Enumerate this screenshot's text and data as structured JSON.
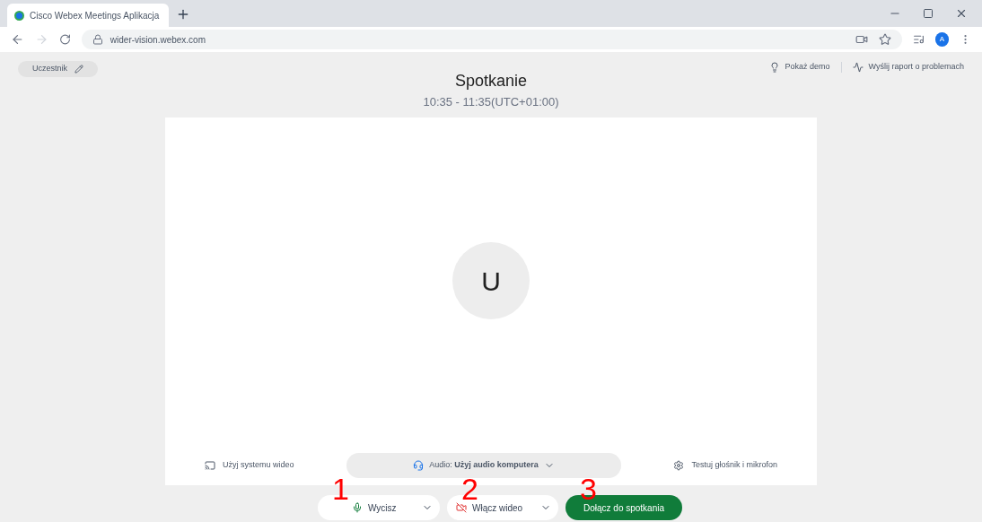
{
  "browser": {
    "tab_title": "Cisco Webex Meetings Aplikacja",
    "url": "wider-vision.webex.com",
    "profile_initial": "A"
  },
  "header": {
    "user_chip": "Uczestnik",
    "links": [
      {
        "kind": "demo",
        "label": "Pokaż demo"
      },
      {
        "kind": "report",
        "label": "Wyślij raport o problemach"
      }
    ]
  },
  "meeting": {
    "title": "Spotkanie",
    "time": "10:35 - 11:35(UTC+01:00)",
    "avatar_initial": "U"
  },
  "options": {
    "video_system": "Użyj systemu wideo",
    "audio": "Audio: **Użyj audio komputera**",
    "test": "Testuj głośnik i mikrofon"
  },
  "actions": [
    {
      "kind": "mic",
      "label": "Wycisz",
      "annotation": "1"
    },
    {
      "kind": "video",
      "label": "Włącz wideo",
      "annotation": "2"
    },
    {
      "kind": "join",
      "label": "Dołącz do spotkania",
      "annotation": "3"
    }
  ]
}
